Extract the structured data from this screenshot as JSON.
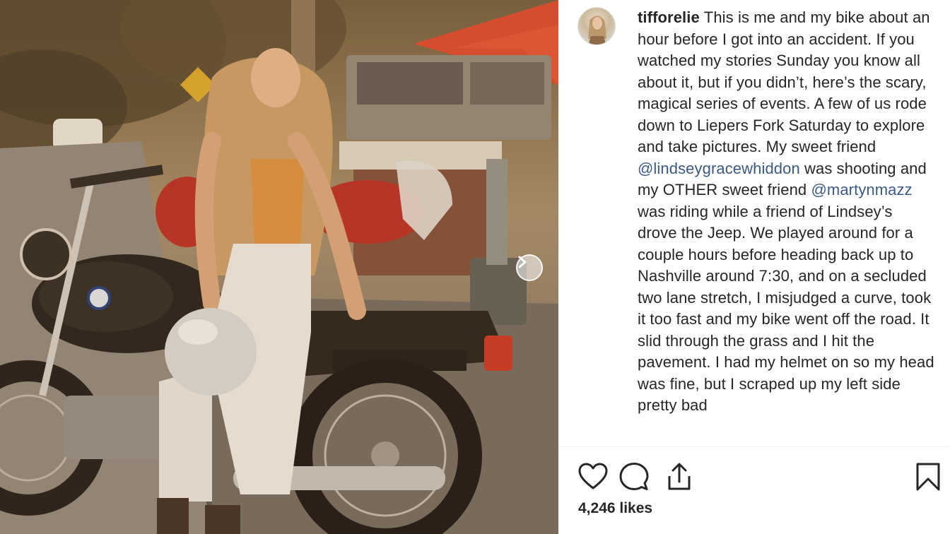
{
  "post": {
    "username": "tifforelie",
    "caption_segments": [
      {
        "type": "text",
        "text": "This is me and my bike about an hour before I got into an accident. If you watched my stories Sunday you know all about it, but if you didn’t, here’s the scary, magical series of events. A few of us rode down to Liepers Fork Saturday to explore and take pictures. My sweet friend "
      },
      {
        "type": "mention",
        "text": "@lindseygracewhiddon"
      },
      {
        "type": "text",
        "text": " was shooting and my OTHER sweet friend "
      },
      {
        "type": "mention",
        "text": "@martynmazz"
      },
      {
        "type": "text",
        "text": " was riding while a friend of Lindsey’s drove the Jeep. We played around for a couple hours before heading back up to Nashville around 7:30, and on a secluded two lane stretch, I misjudged a curve, took it too fast and my bike went off the road. It slid through the grass and I hit the pavement. I had my helmet on so my head was fine, but I scraped up my left side pretty bad"
      }
    ],
    "likes_text": "4,246 likes"
  },
  "icons": {
    "like": "heart-icon",
    "comment": "comment-icon",
    "share": "share-icon",
    "save": "bookmark-icon",
    "next": "chevron-right-icon"
  },
  "colors": {
    "mention": "#3b5a83",
    "text": "#262626",
    "divider": "#efefef"
  }
}
